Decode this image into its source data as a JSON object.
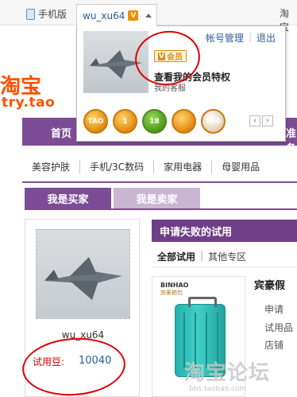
{
  "topbar": {
    "phone_label": "手机版",
    "username": "wu_xu64",
    "vip_mini": "V",
    "right_cut": "淘宝"
  },
  "dropdown": {
    "account_manage": "帐号管理",
    "separator": "|",
    "logout": "退出",
    "vip_badge": "会员",
    "vip_badge_v": "V",
    "vip_privileges": "查看我的会员特权",
    "my_service": "我的客服",
    "medals": [
      "TAO",
      "1",
      "18",
      "",
      "100"
    ],
    "pager_prev": "‹",
    "pager_next": "›"
  },
  "logo": {
    "main": "淘宝",
    "sub": "try.tao"
  },
  "nav": {
    "home": "首页",
    "right_cut": "准备"
  },
  "categories": [
    "美容护肤",
    "手机/3C数码",
    "家用电器",
    "母婴用品"
  ],
  "role_tabs": {
    "buyer": "我是买家",
    "seller": "我是卖家"
  },
  "profile": {
    "name": "wu_xu64",
    "trial_label": "试用豆:",
    "trial_value": "10040"
  },
  "failed": {
    "title": "申请失败的试用",
    "tab_all": "全部试用",
    "tab_sep": "|",
    "tab_other": "其他专区",
    "product_title": "宾豪假",
    "brand": "BINHAO",
    "brand_sub": "宾豪箱包",
    "meta": [
      "申请",
      "试用品",
      "店铺"
    ]
  },
  "watermark": {
    "text": "淘宝论坛",
    "url": "bbs.taobao.com"
  }
}
